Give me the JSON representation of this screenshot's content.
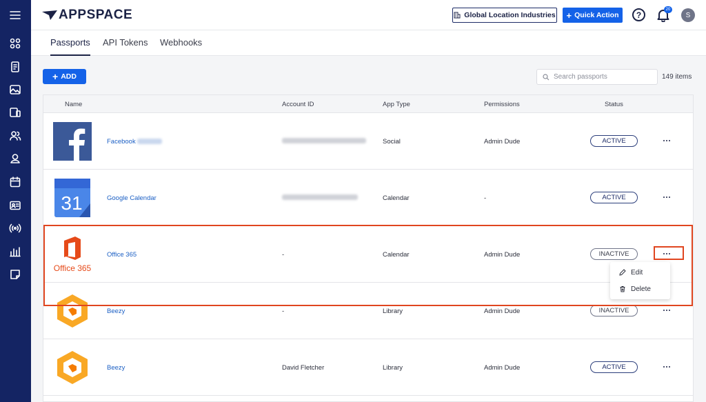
{
  "brand": {
    "logo_text": "APPSPACE"
  },
  "header": {
    "location_label": "Global Location Industries",
    "quick_action_label": "Quick Action",
    "help_label": "?",
    "notification_count": "20",
    "avatar_initial": "S"
  },
  "sidebar": {
    "icons": [
      "menu-icon",
      "dashboard-icon",
      "content-icon",
      "image-icon",
      "devices-icon",
      "users-icon",
      "location-icon",
      "calendar-icon",
      "id-card-icon",
      "broadcast-icon",
      "analytics-icon",
      "note-icon"
    ]
  },
  "tabs": [
    {
      "label": "Passports",
      "active": true
    },
    {
      "label": "API Tokens",
      "active": false
    },
    {
      "label": "Webhooks",
      "active": false
    }
  ],
  "toolbar": {
    "add_label": "ADD",
    "search_placeholder": "Search passports",
    "items_count": "149 items"
  },
  "table": {
    "headers": [
      "Name",
      "Account ID",
      "App Type",
      "Permissions",
      "Status"
    ],
    "rows": [
      {
        "name": "Facebook",
        "account_id": "",
        "app_type": "Social",
        "permissions": "Admin Dude",
        "status": "ACTIVE",
        "logo": "facebook"
      },
      {
        "name": "Google Calendar",
        "account_id": "",
        "app_type": "Calendar",
        "permissions": "-",
        "status": "ACTIVE",
        "logo": "google-calendar",
        "logo_text": "31"
      },
      {
        "name": "Office 365",
        "account_id": "-",
        "app_type": "Calendar",
        "permissions": "Admin Dude",
        "status": "INACTIVE",
        "logo": "office365",
        "logo_text": "Office 365"
      },
      {
        "name": "Beezy",
        "account_id": "-",
        "app_type": "Library",
        "permissions": "Admin Dude",
        "status": "INACTIVE",
        "logo": "beezy"
      },
      {
        "name": "Beezy",
        "account_id": "David Fletcher",
        "app_type": "Library",
        "permissions": "Admin Dude",
        "status": "ACTIVE",
        "logo": "beezy"
      }
    ]
  },
  "row_menu": {
    "edit_label": "Edit",
    "delete_label": "Delete"
  },
  "colors": {
    "sidebar": "#142463",
    "primary": "#1462e8",
    "highlight": "#e0451f"
  }
}
